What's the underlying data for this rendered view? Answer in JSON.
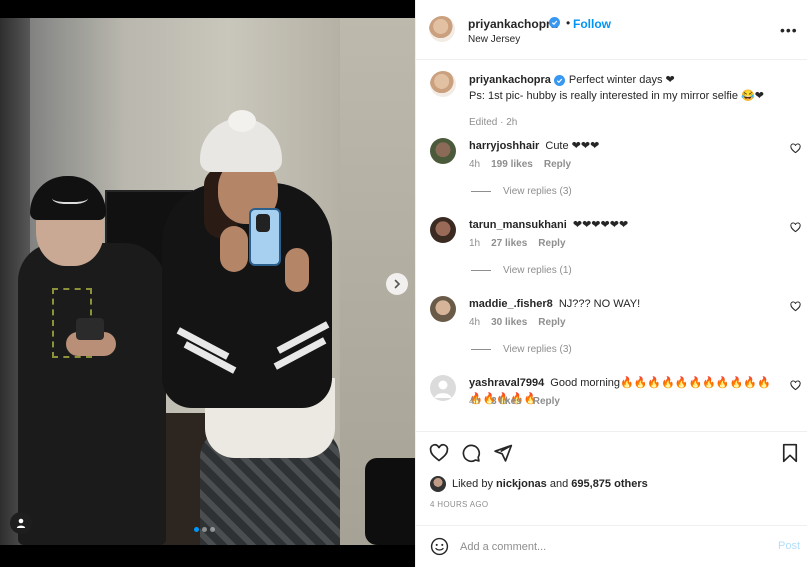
{
  "post": {
    "username": "priyankachopra",
    "follow_label": "Follow",
    "location": "New Jersey",
    "more": "•••",
    "separator": "•"
  },
  "caption": {
    "username": "priyankachopra",
    "line1": "Perfect winter days ❤",
    "line2": "Ps: 1st pic- hubby is really interested in my mirror selfie 😂❤",
    "edited": "Edited · 2h"
  },
  "comments": [
    {
      "username": "harryjoshhair",
      "text": "Cute ❤❤❤",
      "time": "4h",
      "likes": "199 likes",
      "reply": "Reply",
      "view_replies": "View replies (3)"
    },
    {
      "username": "tarun_mansukhani",
      "text": "❤❤❤❤❤❤",
      "time": "1h",
      "likes": "27 likes",
      "reply": "Reply",
      "view_replies": "View replies (1)"
    },
    {
      "username": "maddie_.fisher8",
      "text": "NJ??? NO WAY!",
      "time": "4h",
      "likes": "30 likes",
      "reply": "Reply",
      "view_replies": "View replies (3)"
    },
    {
      "username": "yashraval7994",
      "text": "Good morning🔥🔥🔥🔥🔥🔥🔥🔥🔥🔥🔥🔥🔥🔥🔥🔥",
      "time": "4h",
      "likes": "3 likes",
      "reply": "Reply"
    }
  ],
  "likes": {
    "prefix": "Liked by",
    "user": "nickjonas",
    "middle": "and",
    "others": "695,875 others"
  },
  "timestamp": "4 HOURS AGO",
  "composer": {
    "placeholder": "Add a comment...",
    "post_label": "Post"
  },
  "colors": {
    "accent": "#0095f6",
    "text": "#262626",
    "muted": "#8e8e8e",
    "post_disabled": "#b2dffc"
  },
  "carousel": {
    "total": 3,
    "active_index": 0
  }
}
